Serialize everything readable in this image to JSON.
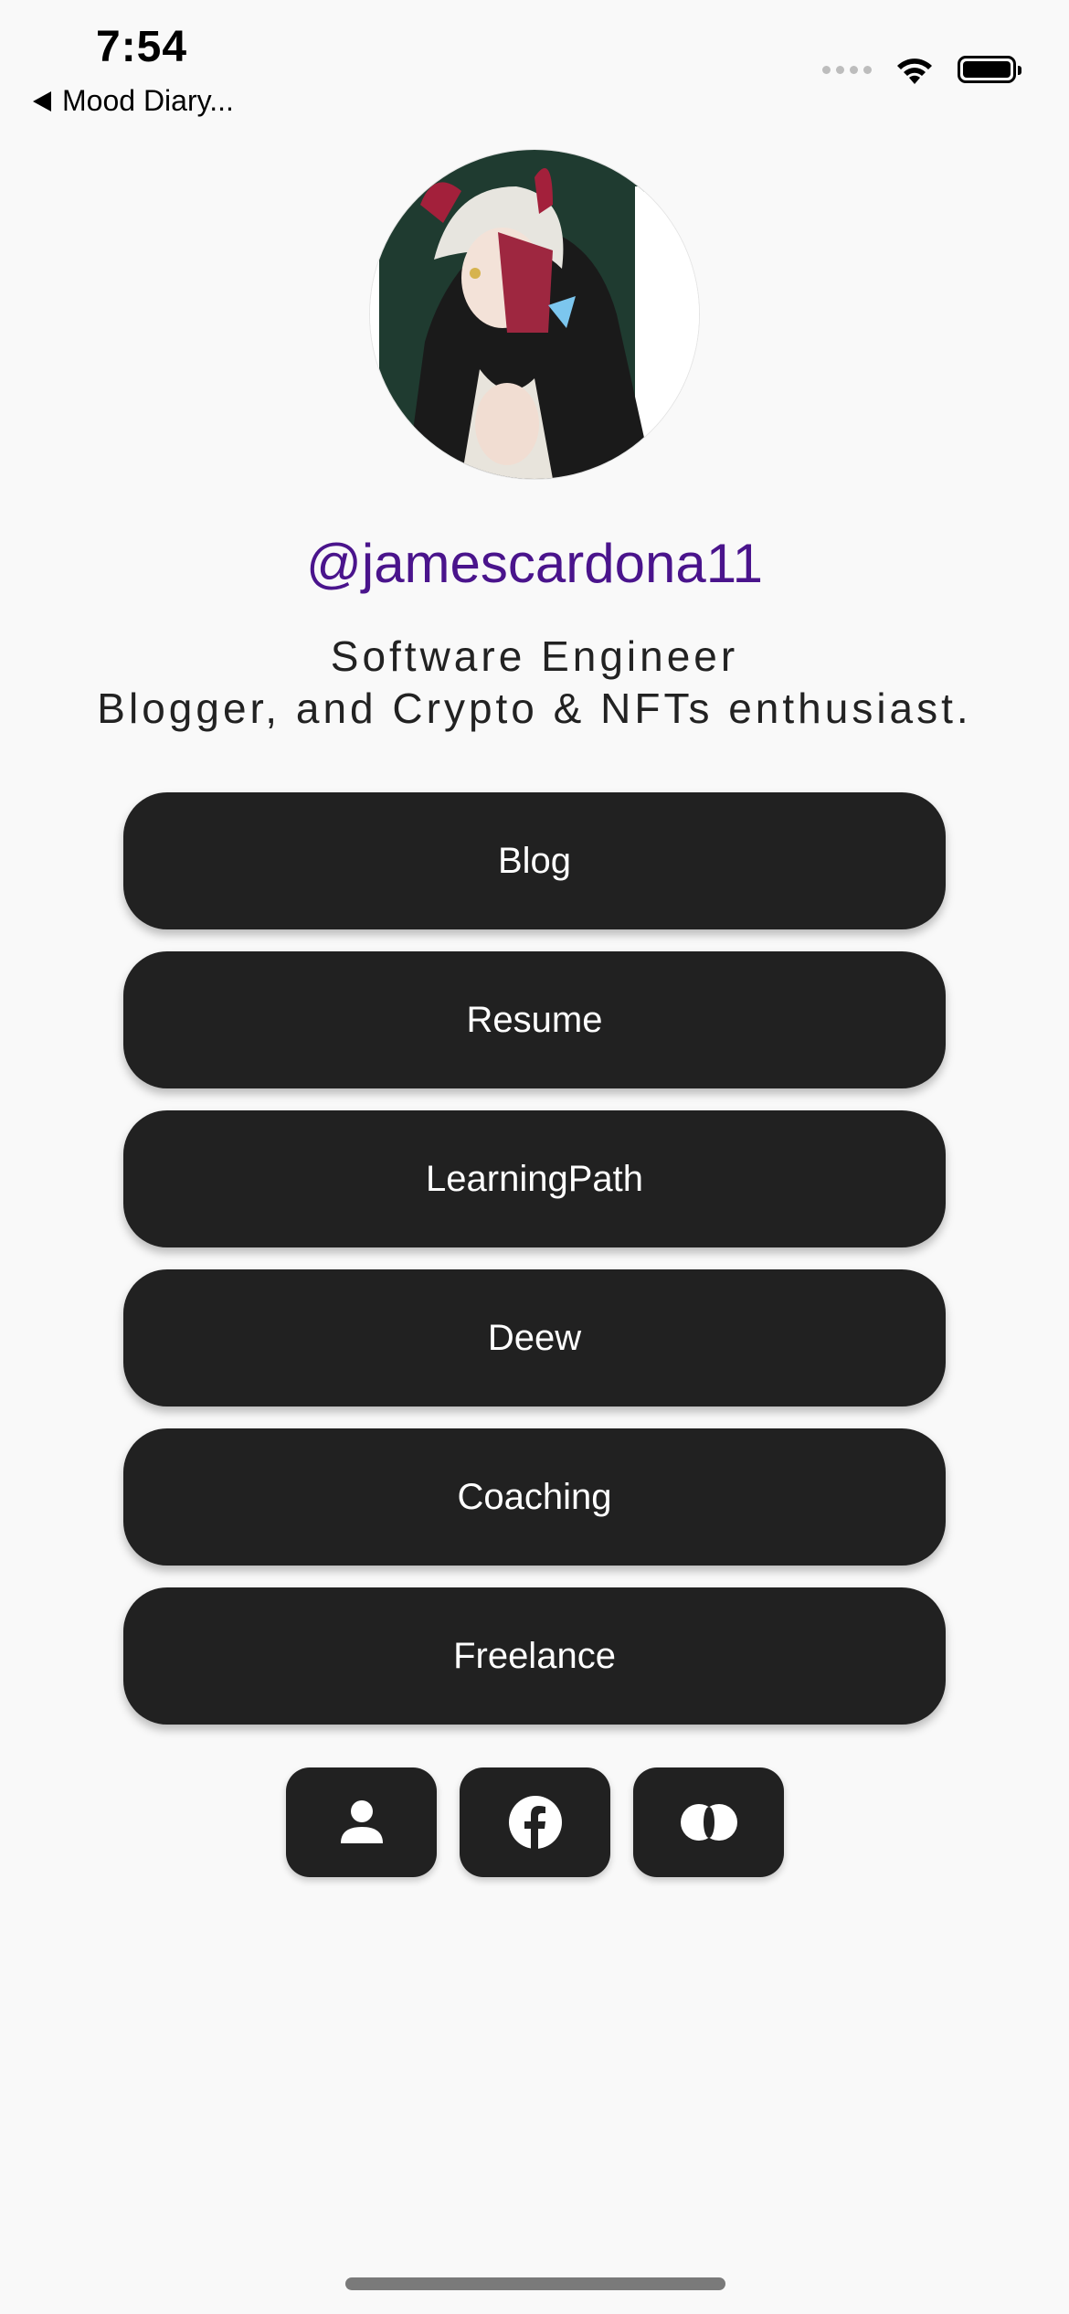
{
  "status_bar": {
    "time": "7:54",
    "back_app": "Mood Diary..."
  },
  "profile": {
    "username": "@jamescardona11",
    "bio_line1": "Software Engineer",
    "bio_line2": "Blogger, and Crypto & NFTs enthusiast."
  },
  "links": [
    {
      "label": "Blog"
    },
    {
      "label": "Resume"
    },
    {
      "label": "LearningPath"
    },
    {
      "label": "Deew"
    },
    {
      "label": "Coaching"
    },
    {
      "label": "Freelance"
    }
  ],
  "social": [
    {
      "icon": "person-icon"
    },
    {
      "icon": "facebook-icon"
    },
    {
      "icon": "overlap-circles-icon"
    }
  ],
  "colors": {
    "background": "#f9f9f9",
    "button": "#212121",
    "username": "#4a148c"
  }
}
